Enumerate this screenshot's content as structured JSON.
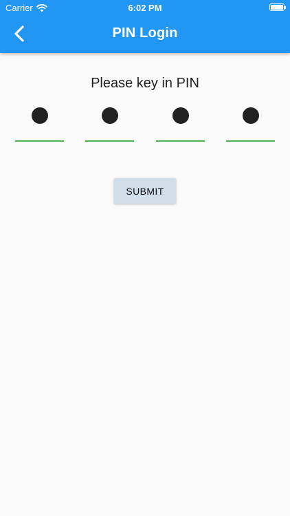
{
  "status_bar": {
    "carrier": "Carrier",
    "time": "6:02 PM",
    "icons": [
      "wifi-icon",
      "battery-icon"
    ]
  },
  "app_bar": {
    "title": "PIN Login",
    "back_icon": "chevron-left-icon",
    "color": "#2196f3"
  },
  "pin": {
    "prompt": "Please key in PIN",
    "digit_count": 4,
    "underline_color": "#4caf50",
    "dot_color": "#212121"
  },
  "submit": {
    "label": "SUBMIT",
    "color": "#d0deea"
  }
}
